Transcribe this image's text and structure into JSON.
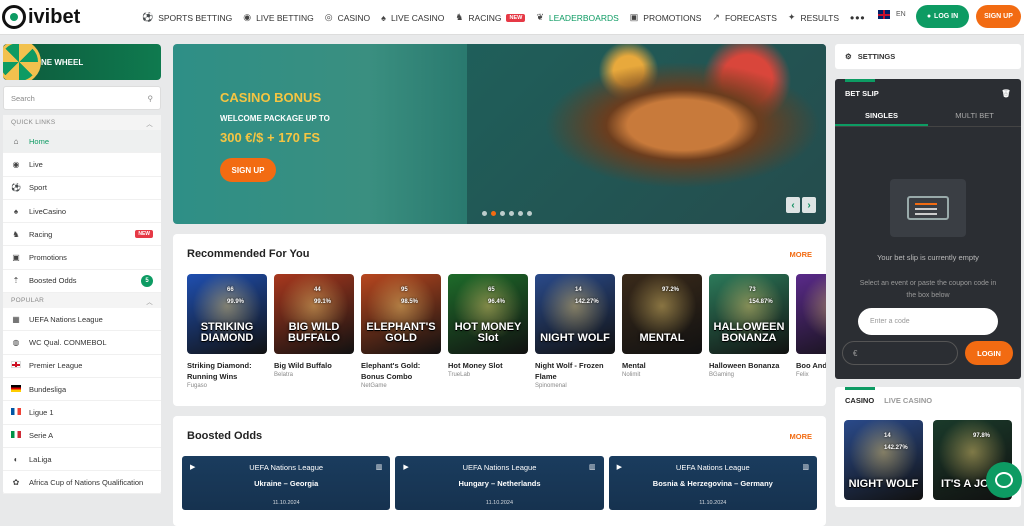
{
  "header": {
    "logo": "ivibet",
    "nav": [
      {
        "label": "SPORTS BETTING",
        "icon": "soccer-ball-icon"
      },
      {
        "label": "LIVE BETTING",
        "icon": "live-icon"
      },
      {
        "label": "CASINO",
        "icon": "casino-chip-icon"
      },
      {
        "label": "LIVE CASINO",
        "icon": "cards-icon"
      },
      {
        "label": "RACING",
        "icon": "horse-icon",
        "badge": "NEW"
      },
      {
        "label": "LEADERBOARDS",
        "icon": "laurel-icon"
      },
      {
        "label": "PROMOTIONS",
        "icon": "gift-icon"
      },
      {
        "label": "FORECASTS",
        "icon": "forecast-icon"
      },
      {
        "label": "RESULTS",
        "icon": "trophy-icon"
      }
    ],
    "more": "•••",
    "lang": "EN",
    "login": "LOG IN",
    "signup": "SIGN UP"
  },
  "sidebar": {
    "wheel_label": "NE WHEEL",
    "search_placeholder": "Search",
    "quick_links_title": "QUICK LINKS",
    "quick_links": [
      {
        "label": "Home",
        "icon": "home-icon"
      },
      {
        "label": "Live",
        "icon": "live-icon"
      },
      {
        "label": "Sport",
        "icon": "soccer-ball-icon"
      },
      {
        "label": "LiveCasino",
        "icon": "cards-icon"
      },
      {
        "label": "Racing",
        "icon": "horse-icon",
        "tag": "NEW"
      },
      {
        "label": "Promotions",
        "icon": "gift-icon"
      },
      {
        "label": "Boosted Odds",
        "icon": "boost-icon",
        "count": "5"
      }
    ],
    "popular_title": "POPULAR",
    "popular": [
      {
        "label": "UEFA Nations League",
        "icon": "uefa-icon"
      },
      {
        "label": "WC Qual. CONMEBOL",
        "icon": "conmebol-icon"
      },
      {
        "label": "Premier League",
        "icon": "flag-england"
      },
      {
        "label": "Bundesliga",
        "icon": "flag-germany"
      },
      {
        "label": "Ligue 1",
        "icon": "flag-france"
      },
      {
        "label": "Serie A",
        "icon": "flag-italy"
      },
      {
        "label": "LaLiga",
        "icon": "laliga-icon"
      },
      {
        "label": "Africa Cup of Nations Qualification",
        "icon": "africa-icon"
      }
    ]
  },
  "banner": {
    "title": "CASINO BONUS",
    "subtitle": "WELCOME PACKAGE UP TO",
    "amount": "300 €/$ + 170 FS",
    "button": "SIGN UP",
    "nav_prev": "‹",
    "nav_next": "›"
  },
  "recommended": {
    "title": "Recommended For You",
    "more": "MORE",
    "games": [
      {
        "name": "Striking Diamond: Running Wins",
        "provider": "Fugaso",
        "players": "66",
        "rtp": "99.9%",
        "art": "STRIKING DIAMOND",
        "color": "#1f4fb0"
      },
      {
        "name": "Big Wild Buffalo",
        "provider": "Belatra",
        "players": "44",
        "rtp": "99.1%",
        "art": "BIG WILD BUFFALO",
        "color": "#a8381e"
      },
      {
        "name": "Elephant's Gold: Bonus Combo",
        "provider": "NetGame",
        "players": "95",
        "rtp": "98.5%",
        "art": "ELEPHANT'S GOLD",
        "color": "#b8471f"
      },
      {
        "name": "Hot Money Slot",
        "provider": "TrueLab",
        "players": "65",
        "rtp": "96.4%",
        "art": "HOT MONEY Slot",
        "color": "#1e6b2a"
      },
      {
        "name": "Night Wolf - Frozen Flame",
        "provider": "Spinomenal",
        "players": "14",
        "rtp": "142.27%",
        "art": "NIGHT WOLF",
        "color": "#2a4a8a"
      },
      {
        "name": "Mental",
        "provider": "Nolimit",
        "players": "",
        "rtp": "97.2%",
        "art": "MENTAL",
        "color": "#3a2a1a"
      },
      {
        "name": "Halloween Bonanza",
        "provider": "BGaming",
        "players": "73",
        "rtp": "154.87%",
        "art": "HALLOWEEN BONANZA",
        "color": "#2c7a5a"
      },
      {
        "name": "Boo And",
        "provider": "Felix",
        "players": "",
        "rtp": "",
        "art": "",
        "color": "#5a2a8a"
      }
    ]
  },
  "boosted": {
    "title": "Boosted Odds",
    "more": "MORE",
    "matches": [
      {
        "league": "UEFA Nations League",
        "teams": "Ukraine – Georgia",
        "date": "11.10.2024"
      },
      {
        "league": "UEFA Nations League",
        "teams": "Hungary – Netherlands",
        "date": "11.10.2024"
      },
      {
        "league": "UEFA Nations League",
        "teams": "Bosnia & Herzegovina – Germany",
        "date": "11.10.2024"
      }
    ]
  },
  "right": {
    "settings": "SETTINGS",
    "betslip_title": "BET SLIP",
    "tab_singles": "SINGLES",
    "tab_multi": "MULTI BET",
    "empty": "Your bet slip is currently empty",
    "note": "Select an event or paste the coupon code in the box below",
    "code_placeholder": "Enter a code",
    "amount_placeholder": "€",
    "login": "LOGIN",
    "casino_tab": "CASINO",
    "live_casino_tab": "LIVE CASINO",
    "casino_games": [
      {
        "players": "14",
        "rtp": "142.27%",
        "art": "NIGHT WOLF",
        "color": "#2a4a8a"
      },
      {
        "players": "",
        "rtp": "97.8%",
        "art": "IT'S A JOKE",
        "color": "#1a3a2a"
      }
    ]
  }
}
